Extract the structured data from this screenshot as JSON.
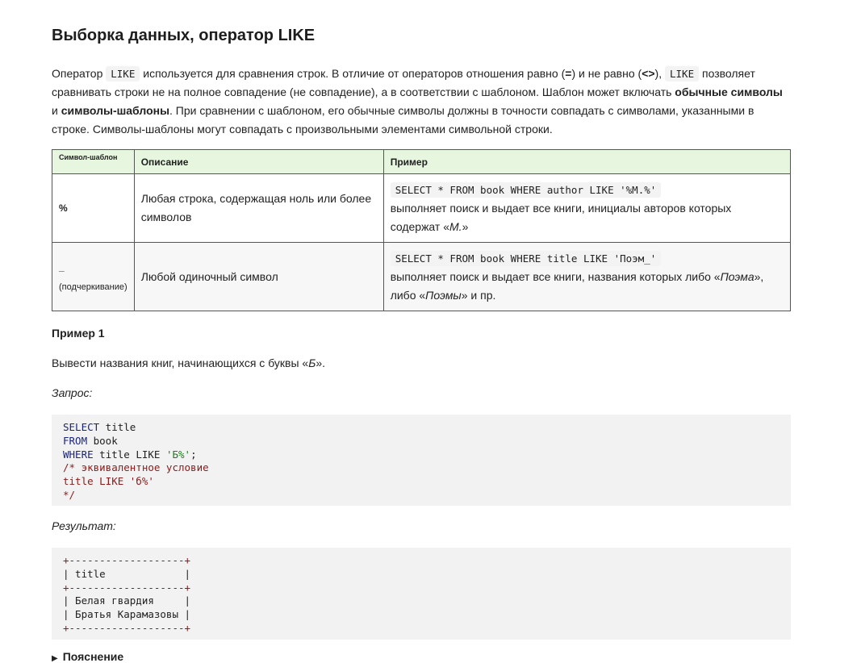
{
  "title": "Выборка данных, оператор LIKE",
  "intro": {
    "p1": "Оператор ",
    "code1": "LIKE",
    "p2": " используется для сравнения строк. В отличие от операторов отношения равно (",
    "eq": "=",
    "p3": ") и не равно (",
    "neq": "<>",
    "p4": "), ",
    "code2": "LIKE",
    "p5": " позволяет сравнивать строки не на полное совпадение (не совпадение), а в соответствии с шаблоном. Шаблон может включать ",
    "b1": "обычные символы",
    "p6": " и ",
    "b2": "символы-шаблоны",
    "p7": ". При сравнении с шаблоном, его обычные символы должны в точности совпадать с символами, указанными в строке. Символы-шаблоны могут совпадать с произвольными элементами символьной строки."
  },
  "table": {
    "headers": [
      "Символ-шаблон",
      "Описание",
      "Пример"
    ],
    "rows": [
      {
        "symbol": "%",
        "symbol_note": "",
        "description": "Любая строка, содержащая ноль или более символов",
        "example_code": "SELECT * FROM book WHERE author LIKE '%М.%'",
        "example_text_1": "выполняет поиск и выдает все книги, инициалы авторов которых содержат «",
        "example_italic_1": "М.",
        "example_text_2": "»",
        "example_italic_2": "",
        "example_text_3": ""
      },
      {
        "symbol": "_",
        "symbol_note": "(подчеркивание)",
        "description": "Любой одиночный символ",
        "example_code": "SELECT * FROM book WHERE title LIKE 'Поэм_'",
        "example_text_1": "выполняет поиск и выдает все книги, названия которых либо «",
        "example_italic_1": "Поэма",
        "example_text_2": "», либо «",
        "example_italic_2": "Поэмы",
        "example_text_3": "» и пр."
      }
    ]
  },
  "example": {
    "heading": "Пример 1",
    "task_prefix": "Вывести названия книг, начинающихся с буквы «",
    "task_letter": "Б",
    "task_suffix": "».",
    "query_label": "Запрос:",
    "query": {
      "kw_select": "SELECT",
      "l1_rest": " title",
      "kw_from": "FROM",
      "l2_rest": " book",
      "kw_where": "WHERE",
      "l3_mid": " title LIKE ",
      "l3_str": "'Б%'",
      "l3_end": ";",
      "comment_1": "/* эквивалентное условие",
      "comment_2": "title LIKE 'б%'",
      "comment_3": "*/"
    },
    "result_label": "Результат:",
    "result": {
      "border": "+-------------------+",
      "header": "| title             |",
      "row1": "| Белая гвардия     |",
      "row2": "| Братья Карамазовы |"
    },
    "explanation": "Пояснение"
  }
}
